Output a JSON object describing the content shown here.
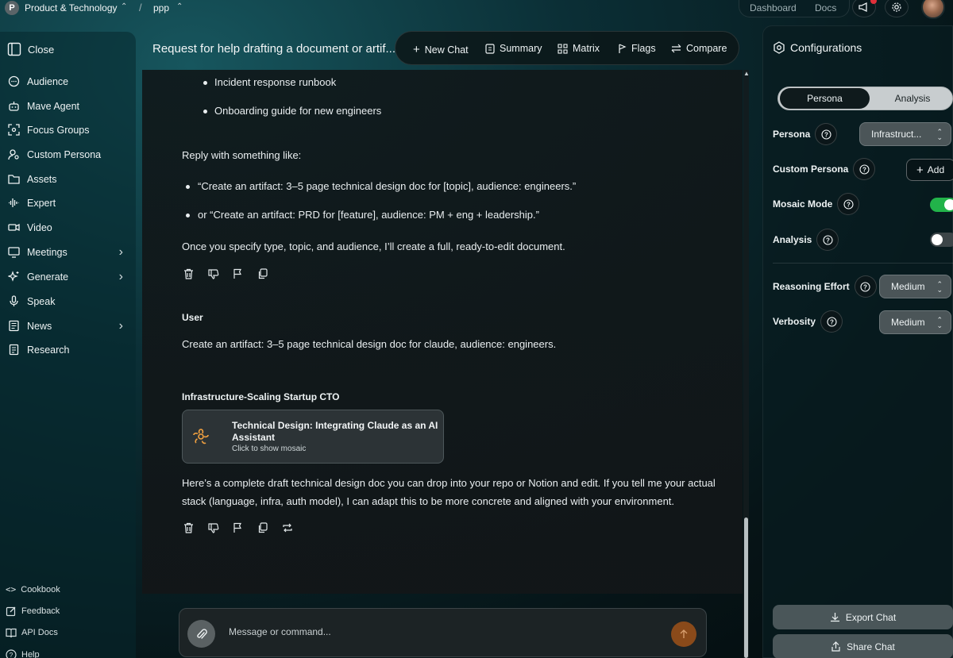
{
  "topbar": {
    "workspace_initial": "P",
    "workspace_name": "Product & Technology",
    "separator": "/",
    "project_name": "ppp",
    "links": [
      "Dashboard",
      "Docs"
    ]
  },
  "sidebar": {
    "close_label": "Close",
    "items": [
      {
        "label": "Audience",
        "icon": "chat-dots-icon"
      },
      {
        "label": "Mave Agent",
        "icon": "robot-icon"
      },
      {
        "label": "Focus Groups",
        "icon": "focus-icon"
      },
      {
        "label": "Custom Persona",
        "icon": "person-search-icon"
      },
      {
        "label": "Assets",
        "icon": "folder-icon"
      },
      {
        "label": "Expert",
        "icon": "waveform-icon"
      },
      {
        "label": "Video",
        "icon": "video-icon"
      },
      {
        "label": "Meetings",
        "icon": "monitor-icon"
      },
      {
        "label": "Generate",
        "icon": "sparkles-icon"
      },
      {
        "label": "Speak",
        "icon": "microphone-icon"
      },
      {
        "label": "News",
        "icon": "newspaper-icon"
      },
      {
        "label": "Research",
        "icon": "document-icon"
      }
    ],
    "footer": [
      {
        "label": "Cookbook",
        "icon": "code-icon"
      },
      {
        "label": "Feedback",
        "icon": "edit-icon"
      },
      {
        "label": "API Docs",
        "icon": "book-icon"
      },
      {
        "label": "Help",
        "icon": "help-icon"
      }
    ]
  },
  "chat": {
    "title": "Request for help drafting a document or artif...",
    "tabs": [
      "New Chat",
      "Summary",
      "Matrix",
      "Flags",
      "Compare"
    ],
    "messages": {
      "bullets_top": [
        "Incident response runbook",
        "Onboarding guide for new engineers"
      ],
      "reply_intro": "Reply with something like:",
      "examples": [
        "“Create an artifact: 3–5 page technical design doc for [topic], audience: engineers.”",
        "or “Create an artifact: PRD for [feature], audience: PM + eng + leadership.”"
      ],
      "closing": "Once you specify type, topic, and audience, I’ll create a full, ready-to-edit document.",
      "user_speaker": "User",
      "user_text": "Create an artifact: 3–5 page technical design doc for claude, audience: engineers.",
      "persona_speaker": "Infrastructure-Scaling Startup CTO",
      "artifact_title": "Technical Design: Integrating Claude as an AI Assistant",
      "artifact_subtitle": "Click to show mosaic",
      "final_line1": "Here’s a complete draft technical design doc you can drop into your repo or Notion and edit. If you tell me your actual",
      "final_line2": "stack (language, infra, auth model), I can adapt this to be more concrete and aligned with your environment."
    },
    "composer_placeholder": "Message or command..."
  },
  "config": {
    "title": "Configurations",
    "segments": [
      "Persona",
      "Analysis"
    ],
    "persona_label": "Persona",
    "persona_value": "Infrastruct...",
    "custom_persona_label": "Custom Persona",
    "add_label": "Add",
    "mosaic_label": "Mosaic Mode",
    "mosaic_on": true,
    "analysis_label": "Analysis",
    "analysis_on": false,
    "reasoning_label": "Reasoning Effort",
    "reasoning_value": "Medium",
    "verbosity_label": "Verbosity",
    "verbosity_value": "Medium",
    "export_label": "Export Chat",
    "share_label": "Share Chat",
    "toggle_on_color": "#22b34a"
  }
}
